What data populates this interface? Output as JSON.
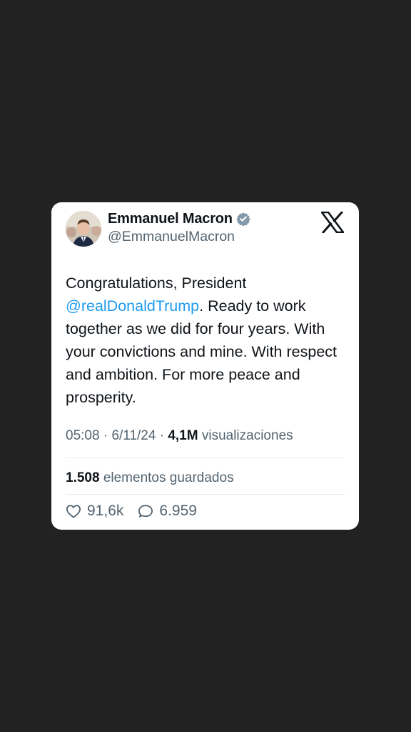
{
  "tweet": {
    "author": {
      "display_name": "Emmanuel Macron",
      "handle": "@EmmanuelMacron",
      "verified_icon": "verified-badge-icon",
      "avatar": "avatar"
    },
    "brand_icon": "x-logo-icon",
    "text": {
      "before_mention": "Congratulations, President ",
      "mention": "@realDonaldTrump",
      "after_mention": ". Ready to work together as we did for four years. With your convictions and mine. With respect and ambition. For more peace and prosperity."
    },
    "meta": {
      "time": "05:08",
      "sep1": "·",
      "date": "6/11/24",
      "sep2": "·",
      "views_count": "4,1M",
      "views_label": "visualizaciones"
    },
    "saved": {
      "count": "1.508",
      "label": "elementos guardados"
    },
    "actions": {
      "likes": "91,6k",
      "likes_icon": "heart-icon",
      "replies": "6.959",
      "replies_icon": "reply-bubble-icon"
    }
  },
  "colors": {
    "background": "#222222",
    "card": "#ffffff",
    "primary_text": "#0f1419",
    "secondary_text": "#536471",
    "link": "#1d9bf0",
    "verified": "#829aab"
  }
}
